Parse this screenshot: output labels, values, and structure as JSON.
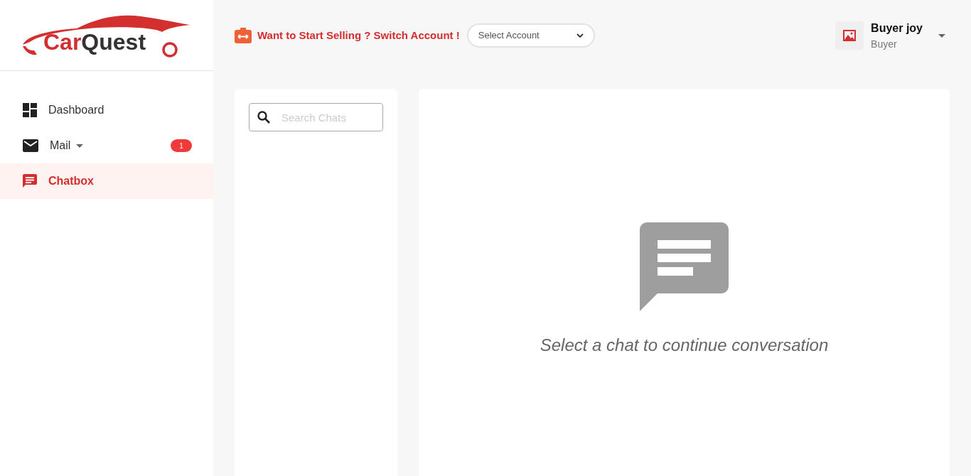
{
  "logo": {
    "part_1": "Car",
    "part_2": "Quest"
  },
  "sidebar": {
    "items": [
      {
        "label": "Dashboard",
        "kind": "dashboard",
        "selected": false
      },
      {
        "label": "Mail",
        "kind": "mail",
        "selected": false,
        "has_menu": true,
        "badge": "1"
      },
      {
        "label": "Chatbox",
        "kind": "chat",
        "selected": true
      }
    ]
  },
  "topbar": {
    "promo": "Want to Start Selling ? Switch Account !",
    "account_select": {
      "value": "Select Account"
    },
    "user": {
      "name": "Buyer joy",
      "role": "Buyer"
    }
  },
  "chat_list": {
    "search": {
      "placeholder": "Search Chats"
    }
  },
  "chat_panel": {
    "empty_message": "Select a chat to continue conversation"
  }
}
